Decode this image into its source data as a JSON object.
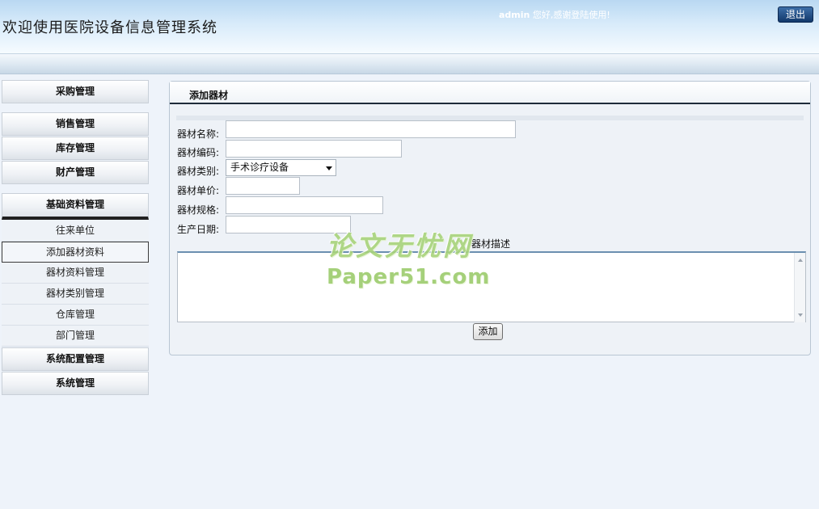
{
  "header": {
    "title": "欢迎使用医院设备信息管理系统",
    "welcome_user": "admin",
    "welcome_text": " 您好,感谢登陆使用!",
    "logout_label": "退出"
  },
  "sidebar": {
    "menus": [
      {
        "label": "采购管理"
      },
      {
        "label": "销售管理"
      },
      {
        "label": "库存管理"
      },
      {
        "label": "财产管理"
      },
      {
        "label": "基础资料管理"
      }
    ],
    "submenu": [
      {
        "label": "往来单位"
      },
      {
        "label": "添加器材资料"
      },
      {
        "label": "器材资料管理"
      },
      {
        "label": "器材类别管理"
      },
      {
        "label": "仓库管理"
      },
      {
        "label": "部门管理"
      }
    ],
    "menus_after": [
      {
        "label": "系统配置管理"
      },
      {
        "label": "系统管理"
      }
    ]
  },
  "panel": {
    "title": "添加器材",
    "fields": {
      "name_label": "器材名称:",
      "name_value": "",
      "code_label": "器材编码:",
      "code_value": "",
      "category_label": "器材类别:",
      "category_value": "手术诊疗设备",
      "price_label": "器材单价:",
      "price_value": "",
      "spec_label": "器材规格:",
      "spec_value": "",
      "date_label": "生产日期:",
      "date_value": ""
    },
    "description_label": "器材描述",
    "description_value": "",
    "add_button_label": "添加"
  },
  "watermark": {
    "cn": "论文无忧网",
    "en": "Paper51.com"
  }
}
